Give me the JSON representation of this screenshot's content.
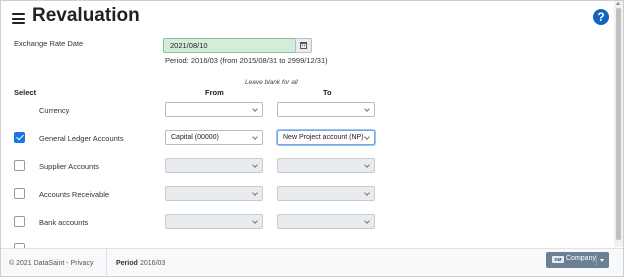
{
  "header": {
    "title": "Revaluation",
    "help_glyph": "?"
  },
  "form": {
    "exchange_rate_label": "Exchange Rate Date",
    "exchange_rate_date": "2021/08/10",
    "period_info": "Period: 2016/03 (from 2015/08/31 to 2999/12/31)"
  },
  "columns": {
    "select": "Select",
    "from": "From",
    "to": "To",
    "hint": "Leave blank for all"
  },
  "rows": [
    {
      "label": "Currency",
      "from": "",
      "to": ""
    },
    {
      "label": "General Ledger Accounts",
      "checked": true,
      "from": "Capital (00000)",
      "to": "New Project account (NP)"
    },
    {
      "label": "Supplier Accounts",
      "checked": false,
      "from": "",
      "to": ""
    },
    {
      "label": "Accounts Receivable",
      "checked": false,
      "from": "",
      "to": ""
    },
    {
      "label": "Bank accounts",
      "checked": false,
      "from": "",
      "to": ""
    }
  ],
  "footer": {
    "copyright": "© 2021 DataSaint - Privacy",
    "period_label": "Period",
    "period_value": "2016/03",
    "company_badge": "DM",
    "company_label": "Company"
  },
  "colors": {
    "accent": "#1a73e8",
    "date_field_bg": "#d4edda",
    "company_button": "#6c8094",
    "help_icon": "#1565c0"
  },
  "icons": [
    "menu-icon",
    "help-icon",
    "calendar-icon",
    "chevron-down-icon",
    "checkmark-icon"
  ]
}
